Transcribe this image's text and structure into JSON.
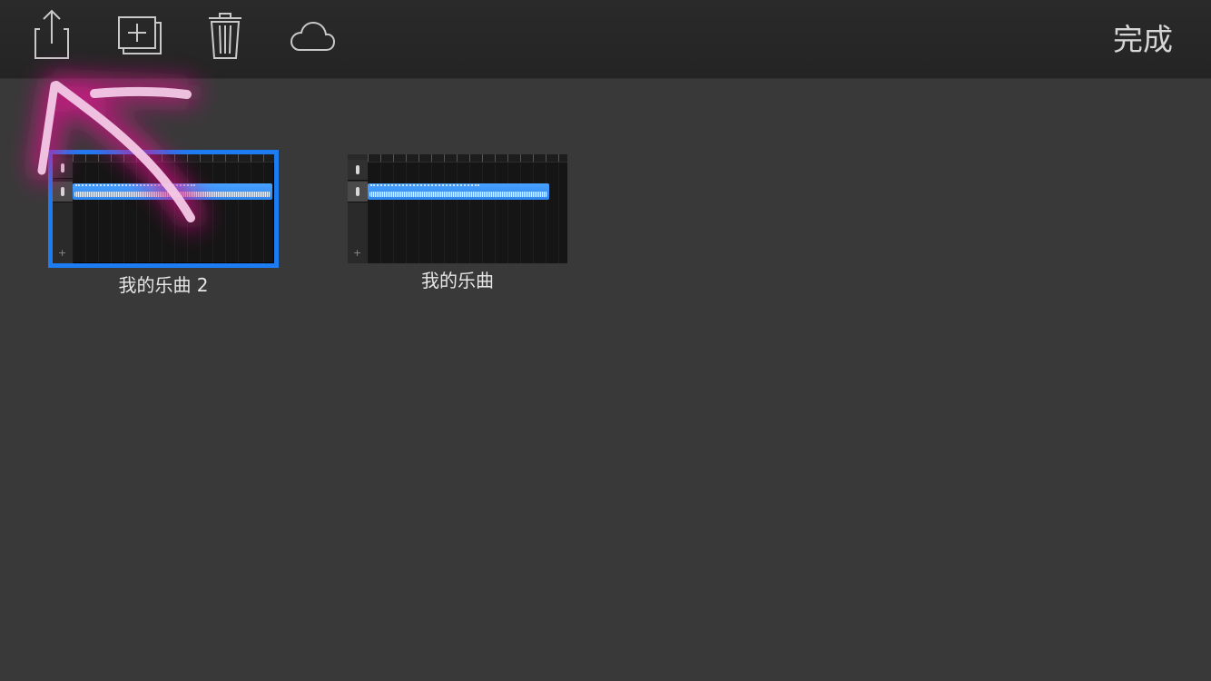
{
  "toolbar": {
    "done_label": "完成",
    "buttons": [
      {
        "name": "share",
        "icon": "share-icon"
      },
      {
        "name": "duplicate",
        "icon": "duplicate-icon"
      },
      {
        "name": "delete",
        "icon": "trash-icon"
      },
      {
        "name": "icloud",
        "icon": "cloud-icon"
      }
    ]
  },
  "songs": [
    {
      "title": "我的乐曲 2",
      "selected": true
    },
    {
      "title": "我的乐曲",
      "selected": false
    }
  ],
  "colors": {
    "background": "#393939",
    "toolbar": "#262626",
    "selection": "#1e7cf2",
    "region": "#3a8ff5",
    "annotation": "#e0148f"
  }
}
